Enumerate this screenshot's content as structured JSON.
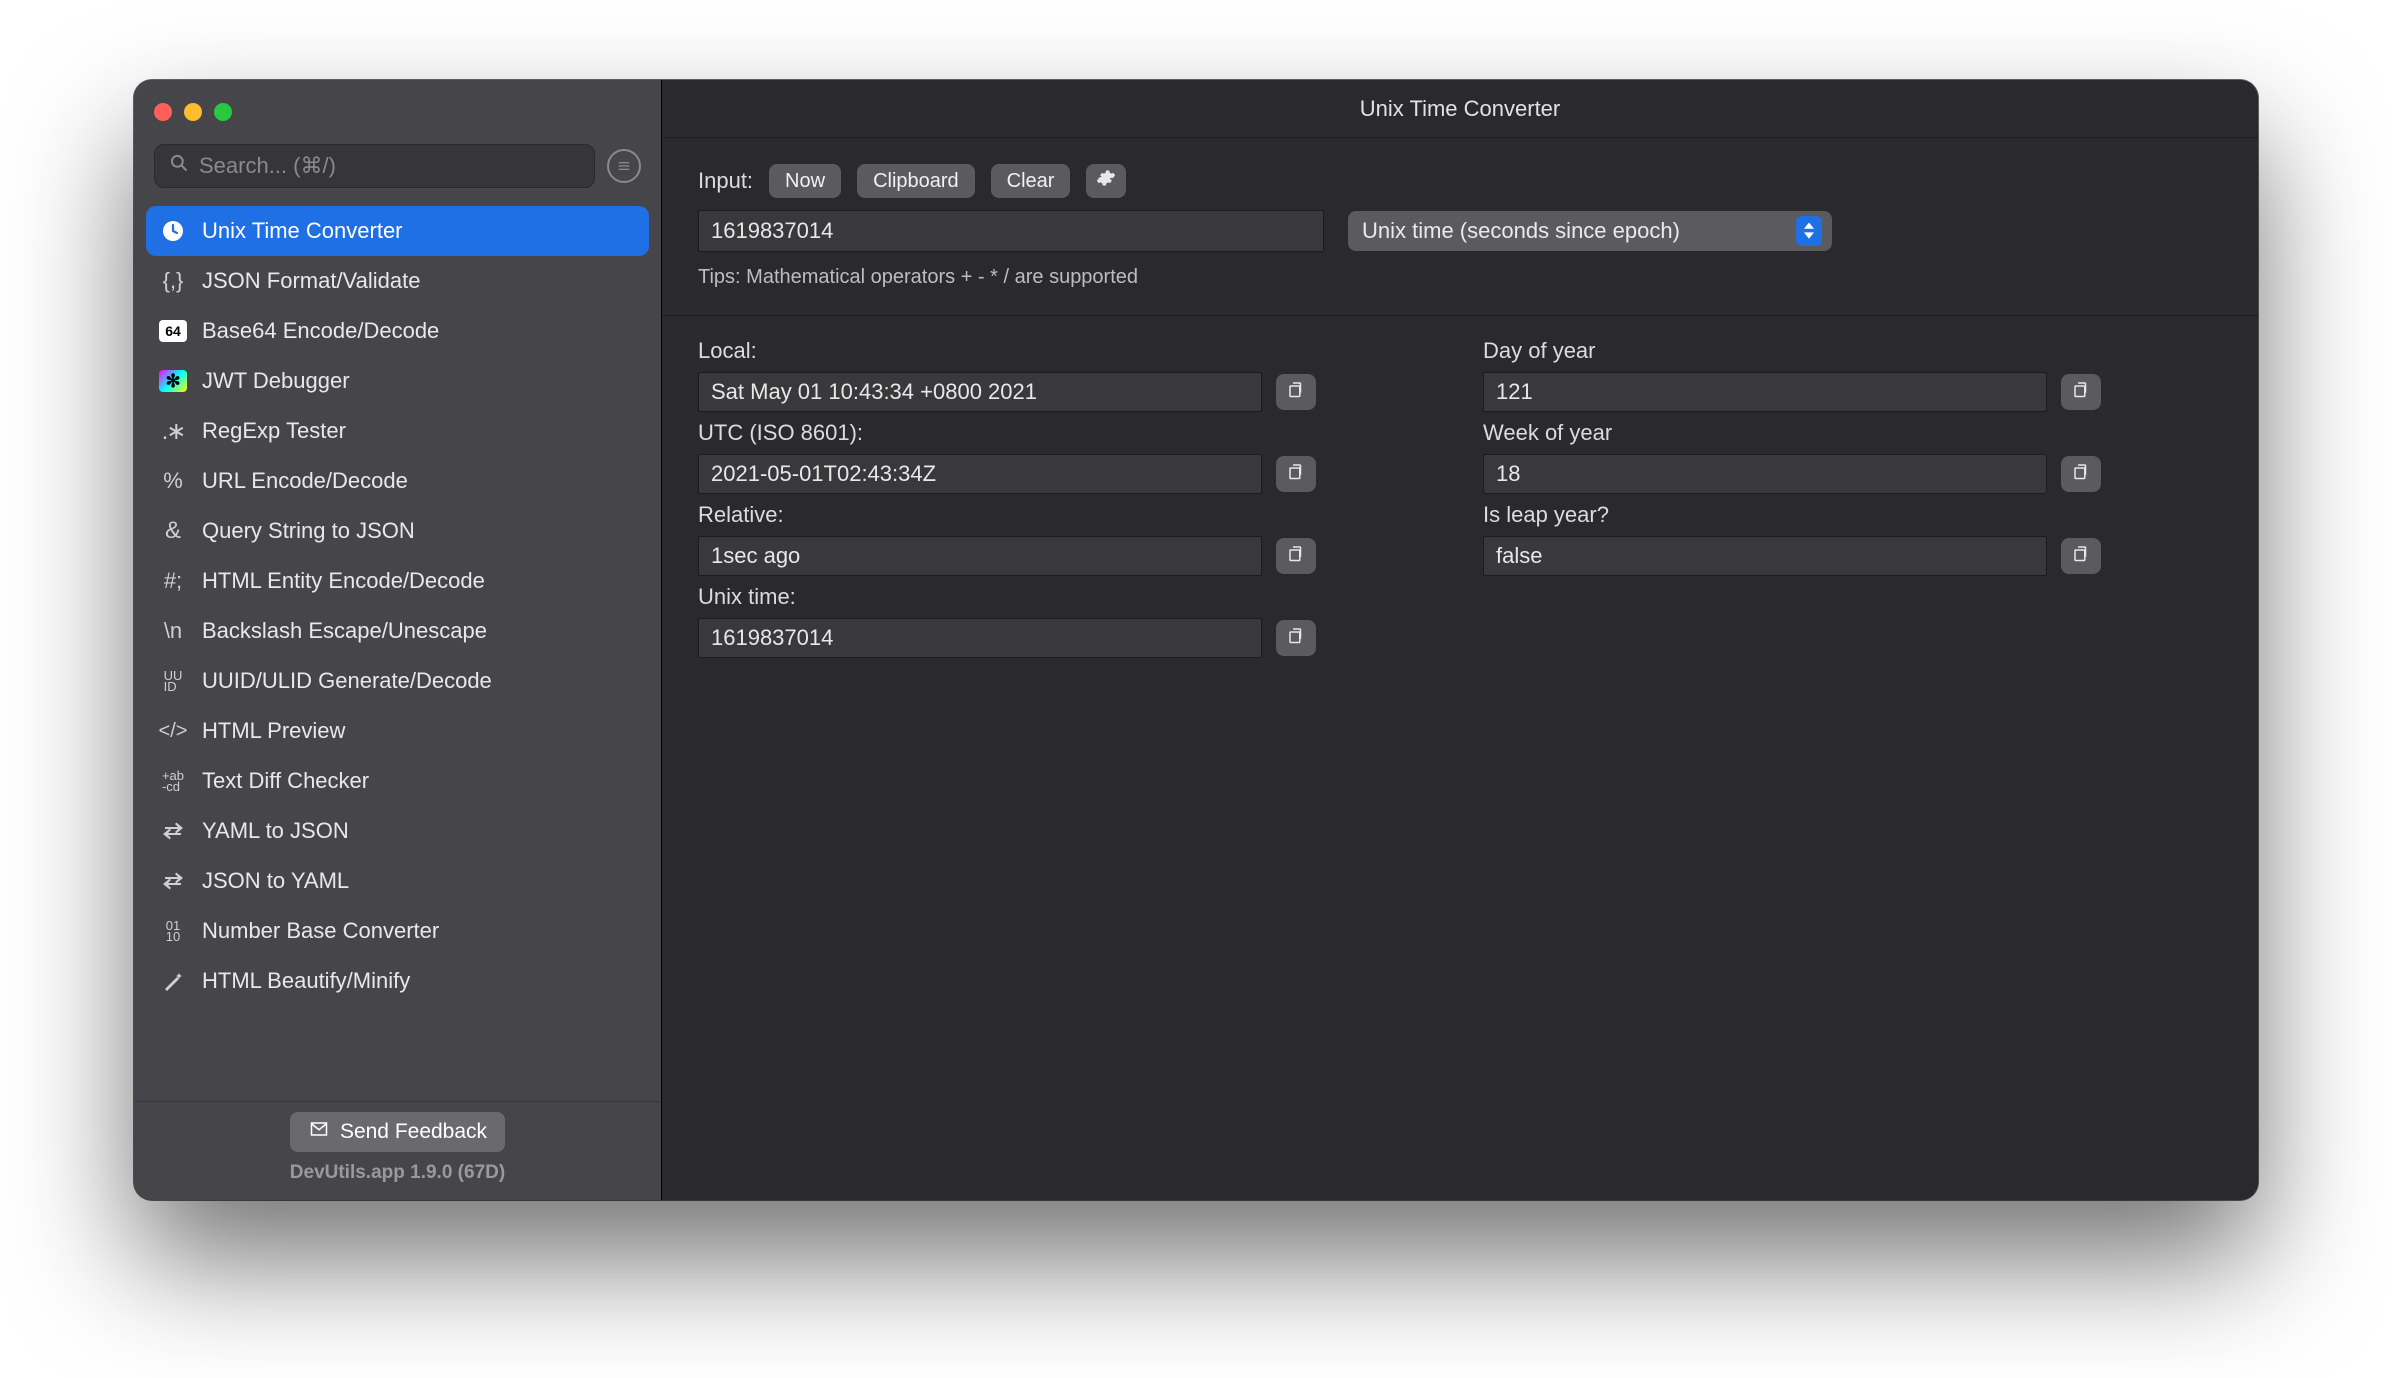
{
  "window": {
    "title": "Unix Time Converter"
  },
  "search": {
    "placeholder": "Search... (⌘/)"
  },
  "sidebar": {
    "tools": [
      {
        "icon": "clock",
        "label": "Unix Time Converter",
        "selected": true
      },
      {
        "icon": "braces",
        "label": "JSON Format/Validate"
      },
      {
        "icon": "base64",
        "label": "Base64 Encode/Decode"
      },
      {
        "icon": "jwt",
        "label": "JWT Debugger"
      },
      {
        "icon": "regex",
        "label": "RegExp Tester"
      },
      {
        "icon": "percent",
        "label": "URL Encode/Decode"
      },
      {
        "icon": "amp",
        "label": "Query String to JSON"
      },
      {
        "icon": "hash",
        "label": "HTML Entity Encode/Decode"
      },
      {
        "icon": "backslash",
        "label": "Backslash Escape/Unescape"
      },
      {
        "icon": "uuid",
        "label": "UUID/ULID Generate/Decode"
      },
      {
        "icon": "htmlcode",
        "label": "HTML Preview"
      },
      {
        "icon": "diff",
        "label": "Text Diff Checker"
      },
      {
        "icon": "swap",
        "label": "YAML to JSON"
      },
      {
        "icon": "swap",
        "label": "JSON to YAML"
      },
      {
        "icon": "bits",
        "label": "Number Base Converter"
      },
      {
        "icon": "wand",
        "label": "HTML Beautify/Minify"
      }
    ],
    "feedback_label": "Send Feedback",
    "version": "DevUtils.app 1.9.0 (67D)"
  },
  "input": {
    "label": "Input:",
    "now": "Now",
    "clipboard": "Clipboard",
    "clear": "Clear",
    "value": "1619837014",
    "format_selected": "Unix time (seconds since epoch)",
    "tips": "Tips: Mathematical operators + - * / are supported"
  },
  "results": {
    "left": [
      {
        "key": "local",
        "label": "Local:",
        "value": "Sat May 01 10:43:34 +0800 2021"
      },
      {
        "key": "utc",
        "label": "UTC (ISO 8601):",
        "value": "2021-05-01T02:43:34Z"
      },
      {
        "key": "relative",
        "label": "Relative:",
        "value": "1sec ago"
      },
      {
        "key": "unix",
        "label": "Unix time:",
        "value": "1619837014"
      }
    ],
    "right": [
      {
        "key": "doy",
        "label": "Day of year",
        "value": "121"
      },
      {
        "key": "woy",
        "label": "Week of year",
        "value": "18"
      },
      {
        "key": "leap",
        "label": "Is leap year?",
        "value": "false"
      }
    ]
  }
}
